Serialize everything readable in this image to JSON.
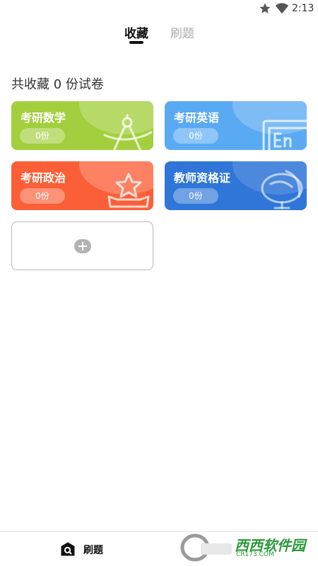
{
  "status_bar": {
    "time": "2:13",
    "icons": [
      "star-icon",
      "wifi-icon"
    ]
  },
  "tabs": [
    {
      "label": "收藏",
      "active": true
    },
    {
      "label": "刷题",
      "active": false
    }
  ],
  "summary": "共收藏 0 份试卷",
  "cards": [
    {
      "title": "考研数学",
      "count": "0份",
      "color": "#a3cf3e",
      "icon": "compass-icon"
    },
    {
      "title": "考研英语",
      "count": "0份",
      "color": "#5aaaf3",
      "icon": "en-board-icon"
    },
    {
      "title": "考研政治",
      "count": "0份",
      "color": "#fb5f38",
      "icon": "star-crown-icon"
    },
    {
      "title": "教师资格证",
      "count": "0份",
      "color": "#2f76d8",
      "icon": "globe-icon"
    }
  ],
  "add_card": {
    "icon": "plus-icon"
  },
  "bottom_nav": {
    "practice_label": "刷题"
  },
  "watermark": {
    "text": "西西软件园",
    "sub": "CR173.COM"
  }
}
